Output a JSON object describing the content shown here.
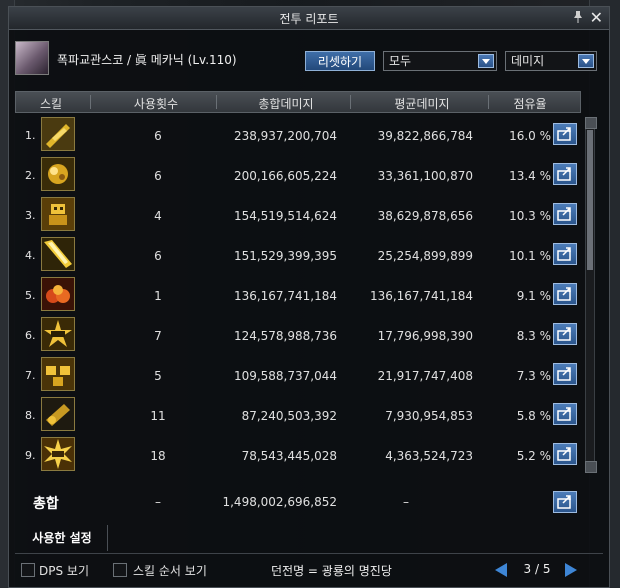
{
  "window": {
    "title": "전투 리포트"
  },
  "character": {
    "name": "폭파교관스코 / 眞 메카닉 (Lv.110)"
  },
  "controls": {
    "reset_label": "리셋하기",
    "filter_value": "모두",
    "metric_value": "데미지"
  },
  "table": {
    "headers": [
      "스킬",
      "사용횟수",
      "총합데미지",
      "평균데미지",
      "점유율"
    ],
    "rows": [
      {
        "rank": "1.",
        "icon": "gold-rockets-icon",
        "uses": "6",
        "total": "238,937,200,704",
        "avg": "39,822,866,784",
        "share": "16.0 %"
      },
      {
        "rank": "2.",
        "icon": "gold-swarm-icon",
        "uses": "6",
        "total": "200,166,605,224",
        "avg": "33,361,100,870",
        "share": "13.4 %"
      },
      {
        "rank": "3.",
        "icon": "robot-icon",
        "uses": "4",
        "total": "154,519,514,624",
        "avg": "38,629,878,656",
        "share": "10.3 %"
      },
      {
        "rank": "4.",
        "icon": "laser-beam-icon",
        "uses": "6",
        "total": "151,529,399,395",
        "avg": "25,254,899,899",
        "share": "10.1 %"
      },
      {
        "rank": "5.",
        "icon": "red-explosion-icon",
        "uses": "1",
        "total": "136,167,741,184",
        "avg": "136,167,741,184",
        "share": "9.1 %"
      },
      {
        "rank": "6.",
        "icon": "counter-burst-icon",
        "uses": "7",
        "total": "124,578,988,736",
        "avg": "17,796,998,390",
        "share": "8.3 %"
      },
      {
        "rank": "7.",
        "icon": "robot-squad-icon",
        "uses": "5",
        "total": "109,588,737,044",
        "avg": "21,917,747,408",
        "share": "7.3 %"
      },
      {
        "rank": "8.",
        "icon": "cannon-icon",
        "uses": "11",
        "total": "87,240,503,392",
        "avg": "7,930,954,853",
        "share": "5.8 %"
      },
      {
        "rank": "9.",
        "icon": "star-burst-icon",
        "uses": "18",
        "total": "78,543,445,028",
        "avg": "4,363,524,723",
        "share": "5.2 %"
      }
    ]
  },
  "total": {
    "label": "총합",
    "uses": "–",
    "total": "1,498,002,696,852",
    "avg": "–"
  },
  "settings_tab": "사용한 설정",
  "footer": {
    "dps_label": "DPS 보기",
    "skill_order_label": "스킬 순서 보기",
    "dungeon": "던전명 = 광룡의 명진당",
    "page": "3 / 5"
  },
  "colors": {
    "accent_blue": "#3e86d6",
    "icon_gold": "#d8a520",
    "window_bg": "#0c0e11"
  }
}
